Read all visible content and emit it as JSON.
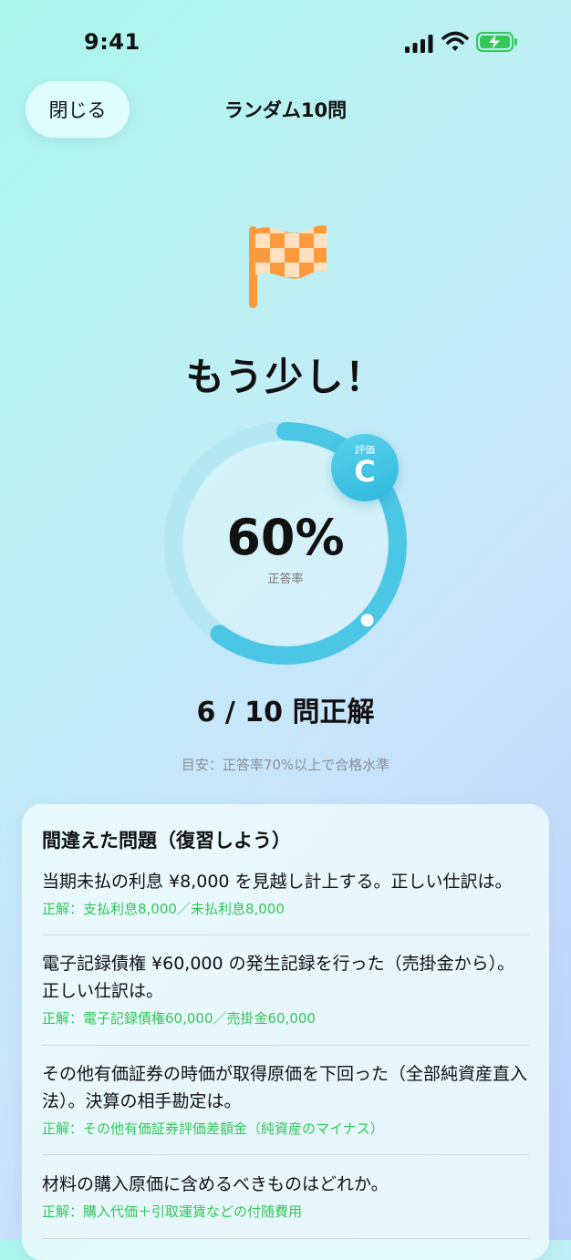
{
  "status_bar": {
    "time": "9:41",
    "icons": [
      "signal-icon",
      "wifi-icon",
      "battery-charging-icon"
    ]
  },
  "header": {
    "close_label": "閉じる",
    "title": "ランダム10問"
  },
  "result": {
    "icon": "checkered-flag-icon",
    "headline": "もう少し！",
    "percent_text": "60%",
    "percent_value": 0.6,
    "percent_label": "正答率",
    "badge_label": "評価",
    "grade": "C",
    "score_text": "6 / 10 問正解",
    "guide_text": "目安：正答率70%以上で合格水準"
  },
  "review": {
    "title": "間違えた問題（復習しよう）",
    "items": [
      {
        "question": "当期未払の利息 ¥8,000 を見越し計上する。正しい仕訳は。",
        "answer": "正解：支払利息8,000／未払利息8,000"
      },
      {
        "question": "電子記録債権 ¥60,000 の発生記録を行った（売掛金から）。正しい仕訳は。",
        "answer": "正解：電子記録債権60,000／売掛金60,000"
      },
      {
        "question": "その他有価証券の時価が取得原価を下回った（全部純資産直入法）。決算の相手勘定は。",
        "answer": "正解：その他有価証券評価差額金（純資産のマイナス）"
      },
      {
        "question": "材料の購入原価に含めるべきものはどれか。",
        "answer": "正解：購入代価＋引取運賃などの付随費用"
      }
    ]
  },
  "colors": {
    "accent": "#3bbfe0",
    "correct": "#34c759",
    "flag": "#ff9a3c"
  }
}
